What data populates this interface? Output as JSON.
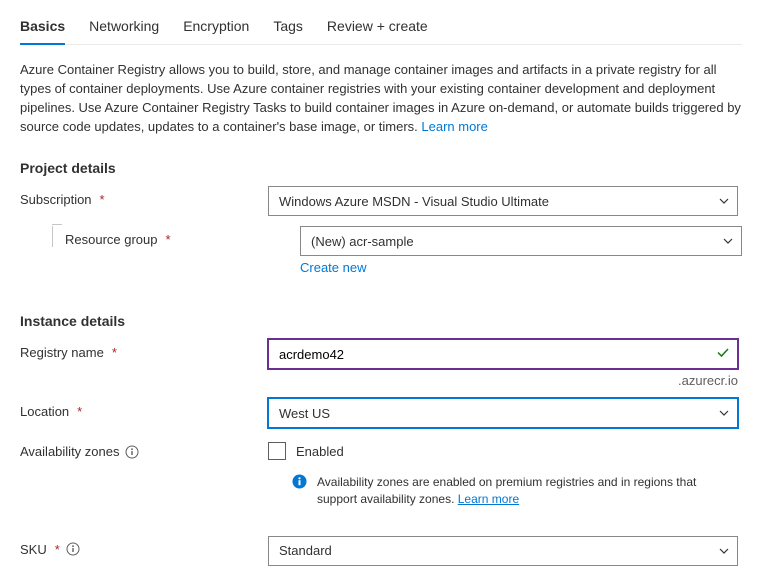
{
  "tabs": {
    "basics": "Basics",
    "networking": "Networking",
    "encryption": "Encryption",
    "tags": "Tags",
    "review": "Review + create"
  },
  "intro": {
    "text": "Azure Container Registry allows you to build, store, and manage container images and artifacts in a private registry for all types of container deployments. Use Azure container registries with your existing container development and deployment pipelines. Use Azure Container Registry Tasks to build container images in Azure on-demand, or automate builds triggered by source code updates, updates to a container's base image, or timers.  ",
    "learn_more": "Learn more"
  },
  "sections": {
    "project": "Project details",
    "instance": "Instance details"
  },
  "labels": {
    "subscription": "Subscription",
    "resource_group": "Resource group",
    "registry_name": "Registry name",
    "location": "Location",
    "availability_zones": "Availability zones",
    "sku": "SKU"
  },
  "fields": {
    "subscription": "Windows Azure MSDN - Visual Studio Ultimate",
    "resource_group": "(New) acr-sample",
    "create_new": "Create new",
    "registry_name": "acrdemo42",
    "registry_suffix": ".azurecr.io",
    "location": "West US",
    "az_enabled_label": "Enabled",
    "az_info": "Availability zones are enabled on premium registries and in regions that support availability zones. ",
    "az_learn_more": "Learn more",
    "sku": "Standard"
  }
}
